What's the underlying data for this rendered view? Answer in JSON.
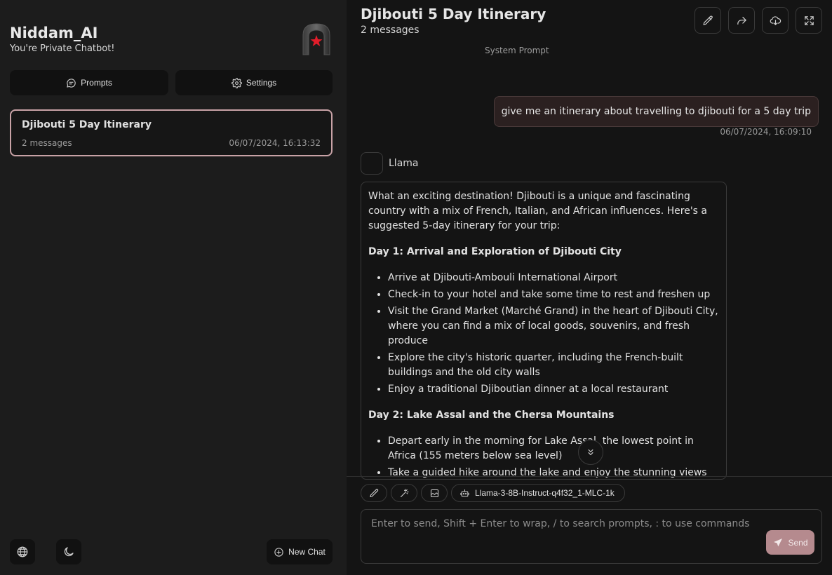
{
  "colors": {
    "sidebar_bg": "#1c1c1c",
    "main_bg": "#141414",
    "accent": "#c8a2a6",
    "send_button": "#b58a8e",
    "logo_red": "#e11d2a"
  },
  "sidebar": {
    "app_name": "Niddam_AI",
    "tagline": "You're Private Chatbot!",
    "logo_icon": "red-star-arch-icon",
    "prompts_label": "Prompts",
    "prompts_icon": "chat-bubble-icon",
    "settings_label": "Settings",
    "settings_icon": "gear-icon",
    "chats": [
      {
        "title": "Djibouti 5 Day Itinerary",
        "count": "2 messages",
        "date": "06/07/2024, 16:13:32"
      }
    ],
    "footer": {
      "language_icon": "globe-icon",
      "theme_icon": "moon-icon",
      "new_chat_icon": "plus-circle-icon",
      "new_chat_label": "New Chat"
    }
  },
  "header": {
    "title": "Djibouti 5 Day Itinerary",
    "message_count": "2 messages",
    "actions": [
      "pencil-icon",
      "share-icon",
      "cloud-download-icon",
      "fullscreen-icon"
    ]
  },
  "system_prompt_label": "System Prompt",
  "messages": {
    "user": {
      "text": "give me an itinerary about travelling to djibouti for a 5 day trip",
      "time": "06/07/2024, 16:09:10"
    },
    "assistant": {
      "name": "Llama",
      "intro": "What an exciting destination! Djibouti is a unique and fascinating country with a mix of French, Italian, and African influences. Here's a suggested 5-day itinerary for your trip:",
      "day1_heading": "Day 1: Arrival and Exploration of Djibouti City",
      "day1_items": [
        "Arrive at Djibouti-Ambouli International Airport",
        "Check-in to your hotel and take some time to rest and freshen up",
        "Visit the Grand Market (Marché Grand) in the heart of Djibouti City, where you can find a mix of local goods, souvenirs, and fresh produce",
        "Explore the city's historic quarter, including the French-built buildings and the old city walls",
        "Enjoy a traditional Djiboutian dinner at a local restaurant"
      ],
      "day2_heading": "Day 2: Lake Assal and the Chersa Mountains",
      "day2_items": [
        "Depart early in the morning for Lake Assal, the lowest point in Africa (155 meters below sea level)",
        "Take a guided hike around the lake and enjoy the stunning views of the surrounding landscape"
      ]
    }
  },
  "toolbar": {
    "tools": [
      "pencil-icon",
      "magic-wand-icon",
      "image-icon"
    ],
    "model_icon": "robot-icon",
    "model_name": "Llama-3-8B-Instruct-q4f32_1-MLC-1k"
  },
  "composer": {
    "placeholder": "Enter to send, Shift + Enter to wrap, / to search prompts, : to use commands",
    "value": "",
    "send_label": "Send",
    "send_icon": "paper-plane-icon"
  }
}
